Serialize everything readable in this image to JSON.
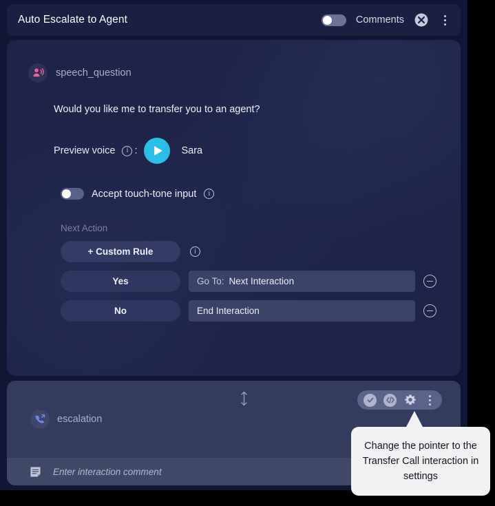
{
  "header": {
    "title": "Auto Escalate to Agent",
    "comments_label": "Comments",
    "comments_toggle_state": "on",
    "close_icon": "close-circle-icon",
    "menu_icon": "kebab-menu-icon"
  },
  "interaction": {
    "node_icon": "speech-question-icon",
    "node_name": "speech_question",
    "prompt_text": "Would you like me to transfer you to an agent?",
    "preview": {
      "label": "Preview voice",
      "info_icon": "info-icon",
      "colon": ":",
      "play_icon": "play-icon",
      "voice_name": "Sara"
    },
    "touch_tone": {
      "label": "Accept touch-tone input",
      "toggle_state": "off",
      "info_icon": "info-icon"
    },
    "next_action": {
      "label": "Next Action",
      "custom_rule_button": "+ Custom Rule",
      "custom_rule_info_icon": "info-icon",
      "rules": [
        {
          "condition": "Yes",
          "prefix": "Go To:",
          "target": "Next Interaction",
          "remove_icon": "minus-circle-icon"
        },
        {
          "condition": "No",
          "prefix": "",
          "target": "End Interaction",
          "remove_icon": "minus-circle-icon"
        }
      ]
    }
  },
  "escalation": {
    "node_icon": "phone-transfer-icon",
    "node_name": "escalation",
    "resize_icon": "resize-vertical-icon",
    "toolbar": [
      {
        "icon": "check-circle-icon",
        "name": "validate-button"
      },
      {
        "icon": "code-icon",
        "name": "code-button"
      },
      {
        "icon": "gear-icon",
        "name": "settings-button"
      },
      {
        "icon": "kebab-menu-icon",
        "name": "more-options-button"
      }
    ],
    "comment": {
      "icon": "note-icon",
      "placeholder": "Enter interaction comment",
      "value": ""
    }
  },
  "tooltip": {
    "text": "Change the pointer to the Transfer Call interaction in settings"
  },
  "colors": {
    "page_background": "#000000",
    "app_background": "#111634",
    "header_background": "#1b2042",
    "main_card_background": "#1e2448",
    "escalation_card_background": "#333c5c",
    "comment_bar_background": "#3f4867",
    "accent_play": "#29bfe8",
    "accent_speech_icon": "#ef5fa0",
    "accent_phone_icon": "#6f86e8",
    "tooltip_background": "#f2f2f4"
  }
}
